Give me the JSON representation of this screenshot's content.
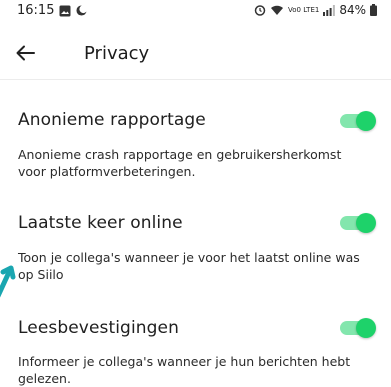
{
  "status_bar": {
    "time": "16:15",
    "network": "Vo0 LTE1",
    "battery": "84%"
  },
  "header": {
    "title": "Privacy"
  },
  "settings": [
    {
      "title": "Anonieme rapportage",
      "description": "Anonieme crash rapportage en gebruikersherkomst voor platformverbeteringen.",
      "enabled": true
    },
    {
      "title": "Laatste keer online",
      "description": "Toon je collega's wanneer je voor het laatst online was op Siilo",
      "enabled": true
    },
    {
      "title": "Leesbevestigingen",
      "description": "Informeer je collega's wanneer je hun berichten hebt gelezen.",
      "enabled": true
    }
  ],
  "colors": {
    "accent": "#1ed26a",
    "edge_arrow": "#1aa6b0"
  }
}
